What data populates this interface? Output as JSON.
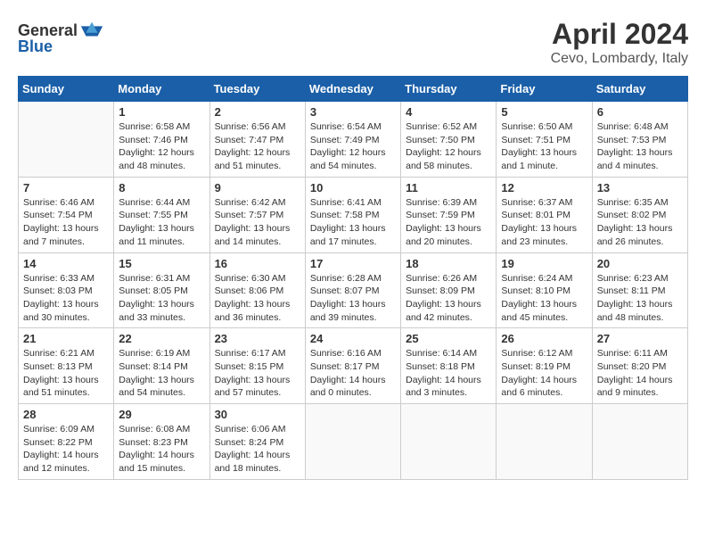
{
  "header": {
    "logo_general": "General",
    "logo_blue": "Blue",
    "title": "April 2024",
    "subtitle": "Cevo, Lombardy, Italy"
  },
  "weekdays": [
    "Sunday",
    "Monday",
    "Tuesday",
    "Wednesday",
    "Thursday",
    "Friday",
    "Saturday"
  ],
  "weeks": [
    [
      {
        "day": "",
        "info": ""
      },
      {
        "day": "1",
        "info": "Sunrise: 6:58 AM\nSunset: 7:46 PM\nDaylight: 12 hours\nand 48 minutes."
      },
      {
        "day": "2",
        "info": "Sunrise: 6:56 AM\nSunset: 7:47 PM\nDaylight: 12 hours\nand 51 minutes."
      },
      {
        "day": "3",
        "info": "Sunrise: 6:54 AM\nSunset: 7:49 PM\nDaylight: 12 hours\nand 54 minutes."
      },
      {
        "day": "4",
        "info": "Sunrise: 6:52 AM\nSunset: 7:50 PM\nDaylight: 12 hours\nand 58 minutes."
      },
      {
        "day": "5",
        "info": "Sunrise: 6:50 AM\nSunset: 7:51 PM\nDaylight: 13 hours\nand 1 minute."
      },
      {
        "day": "6",
        "info": "Sunrise: 6:48 AM\nSunset: 7:53 PM\nDaylight: 13 hours\nand 4 minutes."
      }
    ],
    [
      {
        "day": "7",
        "info": "Sunrise: 6:46 AM\nSunset: 7:54 PM\nDaylight: 13 hours\nand 7 minutes."
      },
      {
        "day": "8",
        "info": "Sunrise: 6:44 AM\nSunset: 7:55 PM\nDaylight: 13 hours\nand 11 minutes."
      },
      {
        "day": "9",
        "info": "Sunrise: 6:42 AM\nSunset: 7:57 PM\nDaylight: 13 hours\nand 14 minutes."
      },
      {
        "day": "10",
        "info": "Sunrise: 6:41 AM\nSunset: 7:58 PM\nDaylight: 13 hours\nand 17 minutes."
      },
      {
        "day": "11",
        "info": "Sunrise: 6:39 AM\nSunset: 7:59 PM\nDaylight: 13 hours\nand 20 minutes."
      },
      {
        "day": "12",
        "info": "Sunrise: 6:37 AM\nSunset: 8:01 PM\nDaylight: 13 hours\nand 23 minutes."
      },
      {
        "day": "13",
        "info": "Sunrise: 6:35 AM\nSunset: 8:02 PM\nDaylight: 13 hours\nand 26 minutes."
      }
    ],
    [
      {
        "day": "14",
        "info": "Sunrise: 6:33 AM\nSunset: 8:03 PM\nDaylight: 13 hours\nand 30 minutes."
      },
      {
        "day": "15",
        "info": "Sunrise: 6:31 AM\nSunset: 8:05 PM\nDaylight: 13 hours\nand 33 minutes."
      },
      {
        "day": "16",
        "info": "Sunrise: 6:30 AM\nSunset: 8:06 PM\nDaylight: 13 hours\nand 36 minutes."
      },
      {
        "day": "17",
        "info": "Sunrise: 6:28 AM\nSunset: 8:07 PM\nDaylight: 13 hours\nand 39 minutes."
      },
      {
        "day": "18",
        "info": "Sunrise: 6:26 AM\nSunset: 8:09 PM\nDaylight: 13 hours\nand 42 minutes."
      },
      {
        "day": "19",
        "info": "Sunrise: 6:24 AM\nSunset: 8:10 PM\nDaylight: 13 hours\nand 45 minutes."
      },
      {
        "day": "20",
        "info": "Sunrise: 6:23 AM\nSunset: 8:11 PM\nDaylight: 13 hours\nand 48 minutes."
      }
    ],
    [
      {
        "day": "21",
        "info": "Sunrise: 6:21 AM\nSunset: 8:13 PM\nDaylight: 13 hours\nand 51 minutes."
      },
      {
        "day": "22",
        "info": "Sunrise: 6:19 AM\nSunset: 8:14 PM\nDaylight: 13 hours\nand 54 minutes."
      },
      {
        "day": "23",
        "info": "Sunrise: 6:17 AM\nSunset: 8:15 PM\nDaylight: 13 hours\nand 57 minutes."
      },
      {
        "day": "24",
        "info": "Sunrise: 6:16 AM\nSunset: 8:17 PM\nDaylight: 14 hours\nand 0 minutes."
      },
      {
        "day": "25",
        "info": "Sunrise: 6:14 AM\nSunset: 8:18 PM\nDaylight: 14 hours\nand 3 minutes."
      },
      {
        "day": "26",
        "info": "Sunrise: 6:12 AM\nSunset: 8:19 PM\nDaylight: 14 hours\nand 6 minutes."
      },
      {
        "day": "27",
        "info": "Sunrise: 6:11 AM\nSunset: 8:20 PM\nDaylight: 14 hours\nand 9 minutes."
      }
    ],
    [
      {
        "day": "28",
        "info": "Sunrise: 6:09 AM\nSunset: 8:22 PM\nDaylight: 14 hours\nand 12 minutes."
      },
      {
        "day": "29",
        "info": "Sunrise: 6:08 AM\nSunset: 8:23 PM\nDaylight: 14 hours\nand 15 minutes."
      },
      {
        "day": "30",
        "info": "Sunrise: 6:06 AM\nSunset: 8:24 PM\nDaylight: 14 hours\nand 18 minutes."
      },
      {
        "day": "",
        "info": ""
      },
      {
        "day": "",
        "info": ""
      },
      {
        "day": "",
        "info": ""
      },
      {
        "day": "",
        "info": ""
      }
    ]
  ]
}
